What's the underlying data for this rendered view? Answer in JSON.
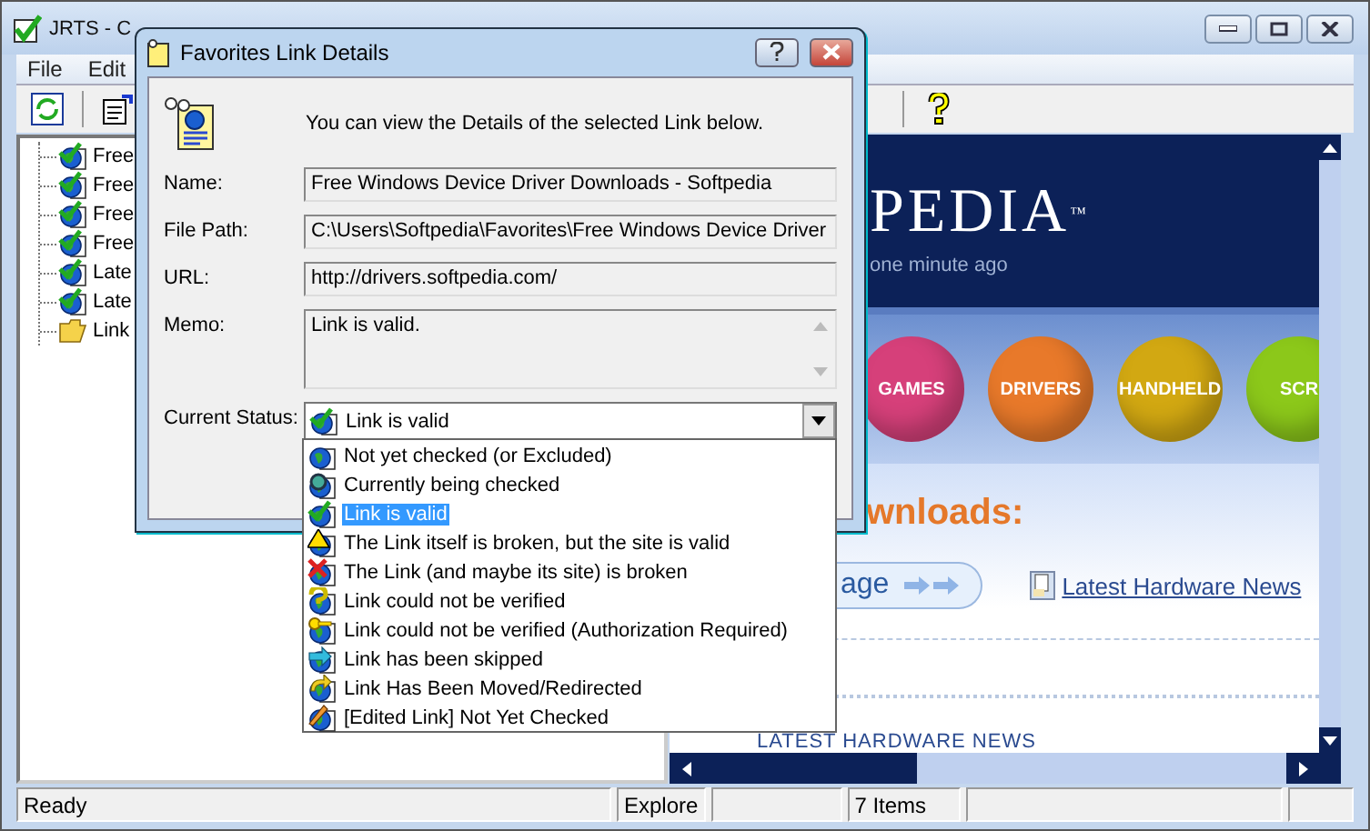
{
  "window": {
    "title": "JRTS - C"
  },
  "menu": [
    "File",
    "Edit"
  ],
  "toolbar": [
    {
      "kind": "refresh"
    },
    {
      "kind": "properties"
    },
    {
      "kind": "help"
    }
  ],
  "tree": {
    "items": [
      {
        "label": "Free",
        "kind": "link"
      },
      {
        "label": "Free",
        "kind": "link"
      },
      {
        "label": "Free",
        "kind": "link"
      },
      {
        "label": "Free",
        "kind": "link"
      },
      {
        "label": "Late",
        "kind": "link"
      },
      {
        "label": "Late",
        "kind": "link"
      },
      {
        "label": "Link",
        "kind": "folder"
      }
    ]
  },
  "browser": {
    "logo": "PEDIA",
    "trademark": "™",
    "updated": "one minute ago",
    "categories": [
      {
        "label": "GAMES",
        "color": "#d6407a"
      },
      {
        "label": "DRIVERS",
        "color": "#e8792a"
      },
      {
        "label": "HANDHELD",
        "color": "#d2a812"
      },
      {
        "label": "SCR",
        "color": "#8cc81a"
      }
    ],
    "heading": "wnloads:",
    "button": "age",
    "link": "Latest Hardware News",
    "section_title": "LATEST HARDWARE NEWS"
  },
  "dialog": {
    "title": "Favorites Link Details",
    "intro": "You can view the Details of the selected Link below.",
    "fields": [
      {
        "label": "Name:",
        "value": "Free Windows Device Driver Downloads - Softpedia",
        "kind": "text"
      },
      {
        "label": "File Path:",
        "value": "C:\\Users\\Softpedia\\Favorites\\Free Windows Device Driver",
        "kind": "text"
      },
      {
        "label": "URL:",
        "value": "http://drivers.softpedia.com/",
        "kind": "text"
      },
      {
        "label": "Memo:",
        "value": "Link is valid.",
        "kind": "memo"
      }
    ],
    "status": {
      "label": "Current Status:",
      "value": "Link is valid",
      "kind": "valid",
      "expanded": true
    },
    "status_options": [
      {
        "label": "Not yet checked (or Excluded)",
        "kind": "unchecked",
        "selected": false
      },
      {
        "label": "Currently being checked",
        "kind": "checking",
        "selected": false
      },
      {
        "label": "Link is valid",
        "kind": "valid",
        "selected": true
      },
      {
        "label": "The Link itself is broken, but the site is valid",
        "kind": "warning",
        "selected": false
      },
      {
        "label": "The Link (and maybe its site) is broken",
        "kind": "broken",
        "selected": false
      },
      {
        "label": "Link could not be verified",
        "kind": "unverified",
        "selected": false
      },
      {
        "label": "Link could not be verified (Authorization Required)",
        "kind": "auth",
        "selected": false
      },
      {
        "label": "Link has been skipped",
        "kind": "skipped",
        "selected": false
      },
      {
        "label": "Link Has Been Moved/Redirected",
        "kind": "moved",
        "selected": false
      },
      {
        "label": "[Edited Link] Not Yet Checked",
        "kind": "edited",
        "selected": false
      }
    ]
  },
  "status_bar": {
    "message": "Ready",
    "view": "Explore",
    "count": "7 Items"
  }
}
